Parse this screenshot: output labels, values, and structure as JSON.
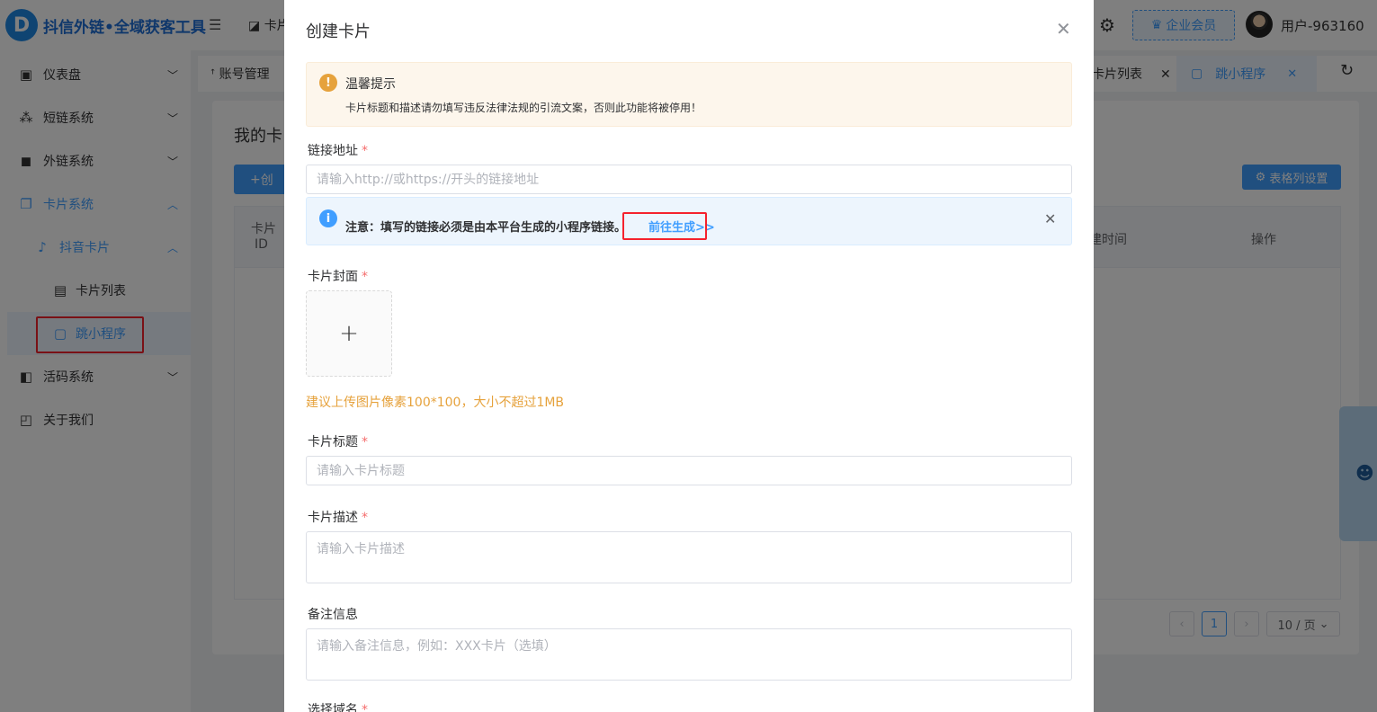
{
  "app": {
    "logo_letter": "D",
    "logo_text": "抖信外链•全域获客工具",
    "top_breadcrumb": "卡片",
    "vip_label": "企业会员",
    "username": "用户-963160"
  },
  "sidebar": {
    "items": [
      {
        "label": "仪表盘"
      },
      {
        "label": "短链系统"
      },
      {
        "label": "外链系统"
      },
      {
        "label": "卡片系统"
      },
      {
        "label": "抖音卡片"
      },
      {
        "label": "卡片列表"
      },
      {
        "label": "跳小程序"
      },
      {
        "label": "活码系统"
      },
      {
        "label": "关于我们"
      }
    ]
  },
  "tags": {
    "first": "账号管理",
    "card_list": "卡片列表",
    "active": "跳小程序"
  },
  "main": {
    "heading": "我的卡",
    "create_btn": "创",
    "column_settings": "表格列设置",
    "columns": {
      "card_id_line1": "卡片",
      "card_id_line2": "ID",
      "created": "建时间",
      "actions": "操作"
    },
    "pager": {
      "current": "1",
      "size": "10 / 页"
    }
  },
  "dialog": {
    "title": "创建卡片",
    "warning": {
      "title": "温馨提示",
      "desc": "卡片标题和描述请勿填写违反法律法规的引流文案，否则此功能将被停用！"
    },
    "link": {
      "label": "链接地址",
      "placeholder": "请输入http://或https://开头的链接地址"
    },
    "notice": {
      "text": "注意：填写的链接必须是由本平台生成的小程序链接。",
      "link": "前往生成>>"
    },
    "cover": {
      "label": "卡片封面",
      "tip": "建议上传图片像素100*100，大小不超过1MB"
    },
    "title_field": {
      "label": "卡片标题",
      "placeholder": "请输入卡片标题"
    },
    "desc_field": {
      "label": "卡片描述",
      "placeholder": "请输入卡片描述"
    },
    "remark_field": {
      "label": "备注信息",
      "placeholder": "请输入备注信息，例如：XXX卡片（选填）"
    },
    "domain_field": {
      "label": "选择域名"
    }
  }
}
